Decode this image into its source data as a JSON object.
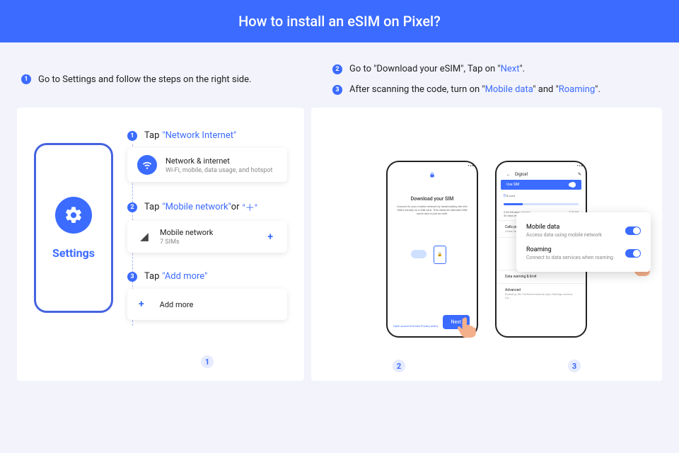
{
  "header": {
    "title": "How to install an eSIM on Pixel?"
  },
  "intro": {
    "left": "Go to Settings and follow the steps on the right side.",
    "right2_a": "Go to \"Download your eSIM\", Tap on \"",
    "right2_link": "Next",
    "right2_b": "\".",
    "right3_a": "After scanning the code, turn on \"",
    "right3_link1": "Mobile data",
    "right3_mid": "\" and \"",
    "right3_link2": "Roaming",
    "right3_b": "\"."
  },
  "settings_label": "Settings",
  "steps": {
    "s1_prefix": "Tap ",
    "s1_hl": "\"Network Internet\"",
    "card1_title": "Network & internet",
    "card1_sub": "Wi-Fi, mobile, data usage, and hotspot",
    "s2_prefix": "Tap ",
    "s2_hl_a": "\"Mobile network\"",
    "s2_mid": " or ",
    "s2_hl_b": "\"＋\"",
    "card2_title": "Mobile network",
    "card2_sub": "7 SIMs",
    "s3_prefix": "Tap ",
    "s3_hl": "\"Add more\"",
    "card3_title": "Add more"
  },
  "phone_dl": {
    "title": "Download your SIM",
    "sub": "Connect to your mobile network by downloading the info that's usually on a SIM card. This replaces standard SIM cards and is just as safe.",
    "privacy": "Open source licenses  Privacy policy",
    "next": "Next"
  },
  "phone_sim": {
    "carrier": "Digicel",
    "use_sim": "Use SIM",
    "zero": "0",
    "bused": "B used",
    "warn": "2.00 GB data warning",
    "days": "30 days left",
    "right_gb": "2.00 GB",
    "calls": "Calls preference",
    "calls_sub": "China Unicom",
    "dw": "Data warning & limit",
    "adv": "Advanced",
    "adv_sub": "Roaming, 5G, Preferred network type, Settings version, Ca..."
  },
  "overlay": {
    "md_title": "Mobile data",
    "md_sub": "Access data using mobile network",
    "rm_title": "Roaming",
    "rm_sub": "Connect to data services when roaming"
  },
  "footnums": {
    "a": "1",
    "b": "2",
    "c": "3"
  }
}
